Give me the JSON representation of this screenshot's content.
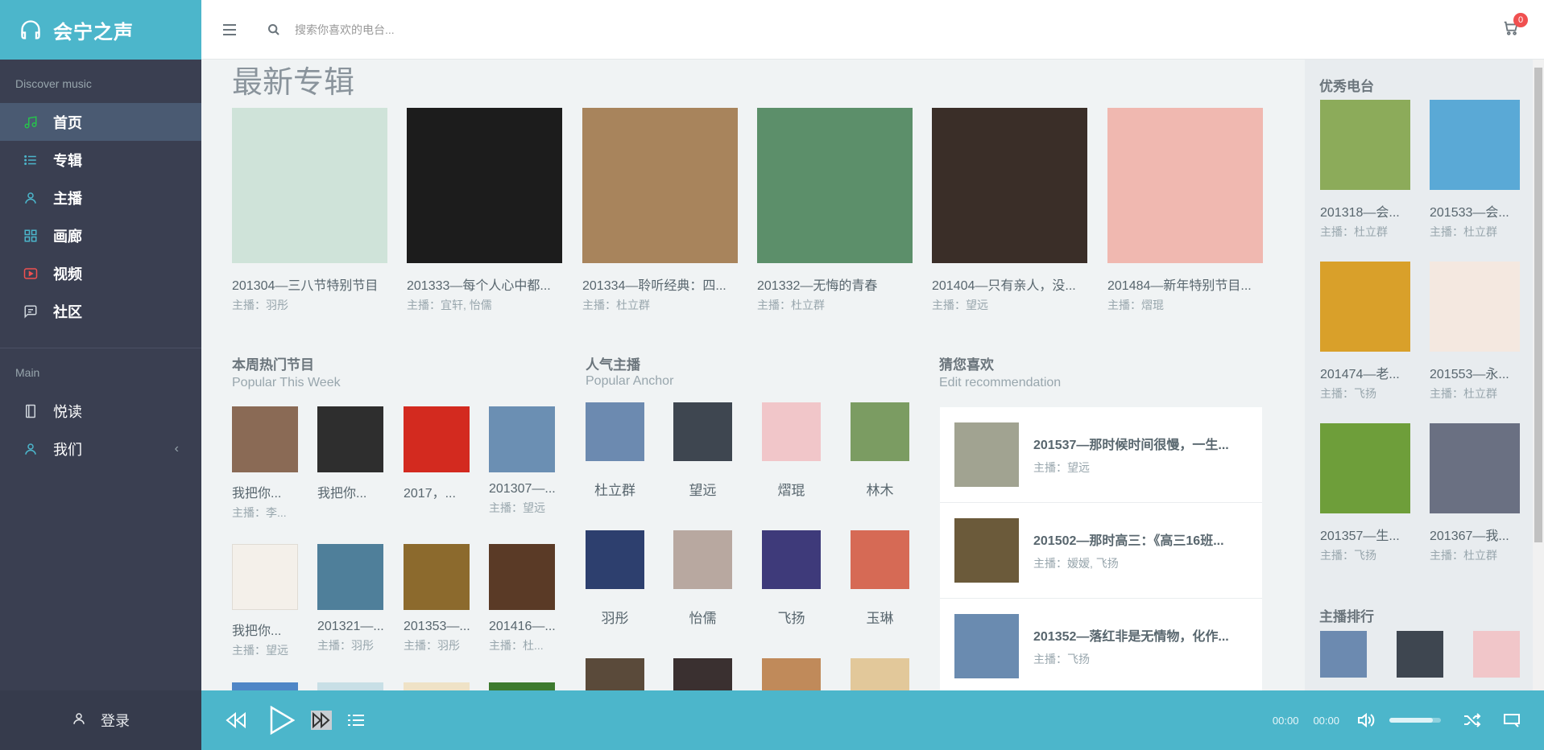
{
  "brand": {
    "title": "会宁之声"
  },
  "sidebar": {
    "header1": "Discover music",
    "items": [
      {
        "label": "首页",
        "icon": "music-note-icon"
      },
      {
        "label": "专辑",
        "icon": "list-icon"
      },
      {
        "label": "主播",
        "icon": "user-icon"
      },
      {
        "label": "画廊",
        "icon": "grid-icon"
      },
      {
        "label": "视频",
        "icon": "video-icon"
      },
      {
        "label": "社区",
        "icon": "chat-icon"
      }
    ],
    "header2": "Main",
    "main_items": [
      {
        "label": "悦读",
        "icon": "book-icon"
      },
      {
        "label": "我们",
        "icon": "user-icon"
      }
    ],
    "login_label": "登录"
  },
  "header": {
    "search_placeholder": "搜索你喜欢的电台...",
    "cart_count": "0"
  },
  "albums": {
    "title": "最新专辑",
    "items": [
      {
        "name": "201304—三八节特别节目",
        "host": "主播：羽彤",
        "color": "#cfe3d9"
      },
      {
        "name": "201333—每个人心中都...",
        "host": "主播：宜轩, 怡儒",
        "color": "#1c1c1c"
      },
      {
        "name": "201334—聆听经典：四...",
        "host": "主播：杜立群",
        "color": "#a8845c"
      },
      {
        "name": "201332—无悔的青春",
        "host": "主播：杜立群",
        "color": "#5c8f6a"
      },
      {
        "name": "201404—只有亲人，没...",
        "host": "主播：望远",
        "color": "#3a2e28"
      },
      {
        "name": "201484—新年特别节目...",
        "host": "主播：熠琨",
        "color": "#f0b8b0"
      }
    ]
  },
  "hot": {
    "title": "本周热门节目",
    "subtitle": "Popular This Week",
    "items": [
      {
        "name": "我把你...",
        "host": "主播：李...",
        "color": "#8a6a55"
      },
      {
        "name": "我把你...",
        "host": "",
        "color": "#2e2e2e"
      },
      {
        "name": "2017，...",
        "host": "",
        "color": "#d32a1f"
      },
      {
        "name": "201307—...",
        "host": "主播：望远",
        "color": "#6b8fb3"
      },
      {
        "name": "我把你...",
        "host": "主播：望远",
        "color": "#f4f0ea"
      },
      {
        "name": "201321—...",
        "host": "主播：羽彤",
        "color": "#4f7f9a"
      },
      {
        "name": "201353—...",
        "host": "主播：羽彤",
        "color": "#8c6a2d"
      },
      {
        "name": "201416—...",
        "host": "主播：杜...",
        "color": "#5a3a26"
      }
    ]
  },
  "anchors": {
    "title": "人气主播",
    "subtitle": "Popular Anchor",
    "items": [
      {
        "name": "杜立群",
        "color": "#6c8ab0"
      },
      {
        "name": "望远",
        "color": "#3e4650"
      },
      {
        "name": "熠琨",
        "color": "#f1c6c9"
      },
      {
        "name": "林木",
        "color": "#7b9c62"
      },
      {
        "name": "羽彤",
        "color": "#2d3f6e"
      },
      {
        "name": "怡儒",
        "color": "#b8a8a0"
      },
      {
        "name": "飞扬",
        "color": "#3e3a7a"
      },
      {
        "name": "玉琳",
        "color": "#d66a55"
      }
    ]
  },
  "recommend": {
    "title": "猜您喜欢",
    "subtitle": "Edit recommendation",
    "items": [
      {
        "title": "201537—那时候时间很慢，一生...",
        "host": "主播：望远",
        "color": "#a1a391"
      },
      {
        "title": "201502—那时高三：《高三16班...",
        "host": "主播：嫒嫒, 飞扬",
        "color": "#6b5a3a"
      },
      {
        "title": "201352—落红非是无情物，化作...",
        "host": "主播：飞扬",
        "color": "#6a8bb0"
      }
    ]
  },
  "aside": {
    "title": "优秀电台",
    "radios": [
      {
        "name": "201318—会...",
        "host": "主播：杜立群",
        "color": "#8cab5a"
      },
      {
        "name": "201533—会...",
        "host": "主播：杜立群",
        "color": "#5aa9d6"
      },
      {
        "name": "201474—老...",
        "host": "主播：飞扬",
        "color": "#d9a02a"
      },
      {
        "name": "201553—永...",
        "host": "主播：杜立群",
        "color": "#f4e8e0"
      },
      {
        "name": "201357—生...",
        "host": "主播：飞扬",
        "color": "#6e9e3a"
      },
      {
        "name": "201367—我...",
        "host": "主播：杜立群",
        "color": "#6a7082"
      }
    ],
    "ranking_title": "主播排行",
    "ranking": [
      {
        "color": "#6c8ab0"
      },
      {
        "color": "#3e4650"
      },
      {
        "color": "#f1c6c9"
      }
    ]
  },
  "player": {
    "current_time": "00:00",
    "total_time": "00:00",
    "volume": 0.85
  },
  "colors": {
    "accent": "#4cb6cb",
    "sidebar": "#3a3f51",
    "badge": "#f05050"
  }
}
